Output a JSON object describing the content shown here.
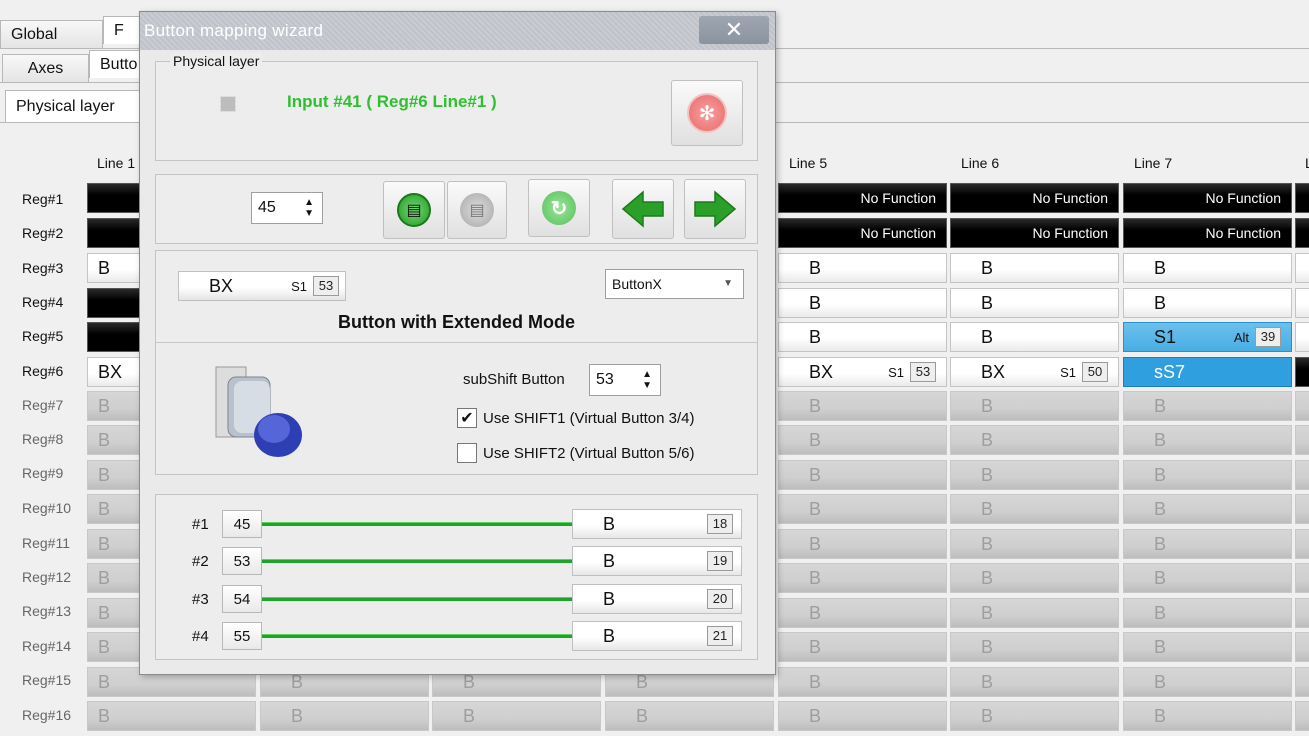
{
  "tabs": {
    "row1": [
      "Global",
      "F"
    ],
    "row2": [
      "Axes",
      "Butto"
    ],
    "row3": [
      "Physical layer"
    ]
  },
  "grid": {
    "columns": [
      "Line 1",
      "Line 5",
      "Line 6",
      "Line 7",
      "L"
    ],
    "rows": [
      "Reg#1",
      "Reg#2",
      "Reg#3",
      "Reg#4",
      "Reg#5",
      "Reg#6",
      "Reg#7",
      "Reg#8",
      "Reg#9",
      "Reg#10",
      "Reg#11",
      "Reg#12",
      "Reg#13",
      "Reg#14",
      "Reg#15",
      "Reg#16"
    ],
    "no_function": "No Function",
    "b": "B",
    "bx": "BX",
    "s1": "S1",
    "alt": "Alt",
    "alt_num": "39",
    "reg6": {
      "line5_num": "53",
      "line6_num": "50",
      "line7_text": "sS7"
    },
    "reg5_line7": "S1"
  },
  "dialog": {
    "title": "Button mapping wizard",
    "close": "✕",
    "physical_layer_legend": "Physical layer",
    "input_text": "Input #41  ( Reg#6  Line#1 )",
    "spinner_value": "45",
    "button_type": {
      "label": "BX",
      "shift": "S1",
      "num": "53",
      "select_value": "ButtonX",
      "description": "Button  with Extended Mode"
    },
    "subshift": {
      "label": "subShift Button",
      "value": "53"
    },
    "checkboxes": [
      {
        "label": "Use SHIFT1 (Virtual Button 3/4)",
        "checked": true
      },
      {
        "label": "Use SHIFT2 (Virtual Button 5/6)",
        "checked": false
      }
    ],
    "mappings": [
      {
        "label": "#1",
        "input": "45",
        "button": "B",
        "num": "18"
      },
      {
        "label": "#2",
        "input": "53",
        "button": "B",
        "num": "19"
      },
      {
        "label": "#3",
        "input": "54",
        "button": "B",
        "num": "20"
      },
      {
        "label": "#4",
        "input": "55",
        "button": "B",
        "num": "21"
      }
    ]
  }
}
